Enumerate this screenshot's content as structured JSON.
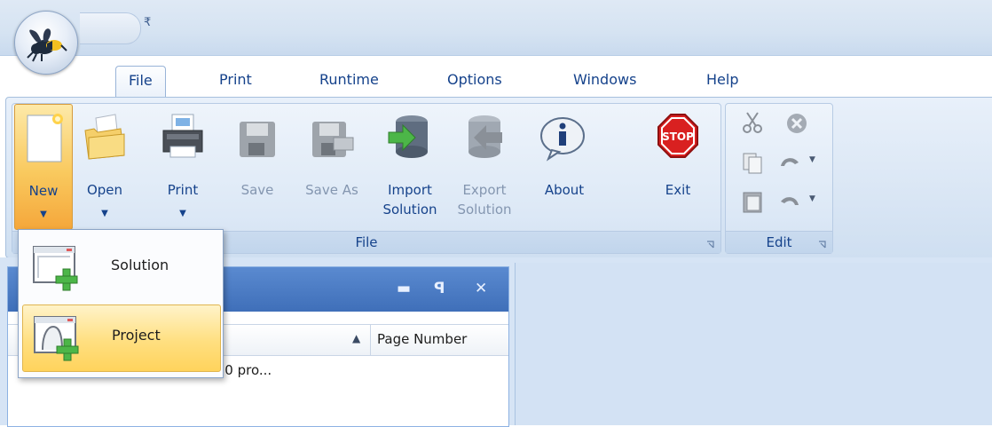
{
  "tabs": [
    "File",
    "Print",
    "Runtime",
    "Options",
    "Windows",
    "Help"
  ],
  "quick_access_caret": "₹",
  "ribbon": {
    "file_group": {
      "label": "File",
      "buttons": {
        "new": {
          "label": "New",
          "caret": "▼"
        },
        "open": {
          "label": "Open",
          "caret": "▼"
        },
        "print": {
          "label": "Print",
          "caret": "▼"
        },
        "save": {
          "label": "Save"
        },
        "save_as": {
          "label": "Save As"
        },
        "import": {
          "line1": "Import",
          "line2": "Solution"
        },
        "export": {
          "line1": "Export",
          "line2": "Solution"
        },
        "about": {
          "label": "About"
        },
        "exit": {
          "label": "Exit"
        }
      }
    },
    "edit_group": {
      "label": "Edit",
      "caret": "▼"
    }
  },
  "new_menu": {
    "items": [
      {
        "label": "Solution"
      },
      {
        "label": "Project"
      }
    ]
  },
  "explorer": {
    "controls": {
      "minimize": "▬",
      "pin": "ꟼ",
      "close": "✕"
    },
    "sort_arrow": "▲",
    "column_page_number": "Page Number",
    "tree_item": "Solution 'Hsbee Explorer'(0 pro..."
  },
  "colors": {
    "accent": "#15428b",
    "highlight": "#ffd35c",
    "ribbon_bg": "#dbe7f5"
  }
}
